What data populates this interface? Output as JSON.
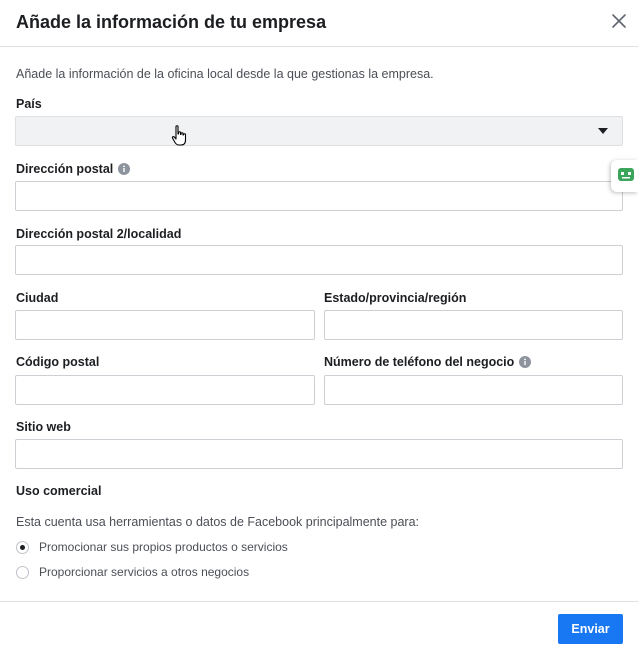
{
  "dialog": {
    "title": "Añade la información de tu empresa",
    "intro": "Añade la información de la oficina local desde la que gestionas la empresa."
  },
  "form": {
    "country": {
      "label": "País",
      "value": ""
    },
    "address1": {
      "label": "Dirección postal",
      "value": "",
      "icon": "info-icon"
    },
    "address2": {
      "label": "Dirección postal 2/localidad",
      "value": ""
    },
    "city": {
      "label": "Ciudad",
      "value": ""
    },
    "state": {
      "label": "Estado/provincia/región",
      "value": ""
    },
    "postal": {
      "label": "Código postal",
      "value": ""
    },
    "phone": {
      "label": "Número de teléfono del negocio",
      "value": "",
      "icon": "info-icon"
    },
    "website": {
      "label": "Sitio web",
      "value": ""
    }
  },
  "usage": {
    "label": "Uso comercial",
    "description": "Esta cuenta usa herramientas o datos de Facebook principalmente para:",
    "options": [
      {
        "label": "Promocionar sus propios productos o servicios",
        "checked": true
      },
      {
        "label": "Proporcionar servicios a otros negocios",
        "checked": false
      }
    ]
  },
  "footer": {
    "submit_label": "Enviar"
  },
  "colors": {
    "primary": "#1877f2",
    "border": "#ccd0d5",
    "select_bg": "#f1f2f4",
    "text": "#1c1e21",
    "muted": "#4b4f56",
    "badge": "#3ba55c"
  }
}
